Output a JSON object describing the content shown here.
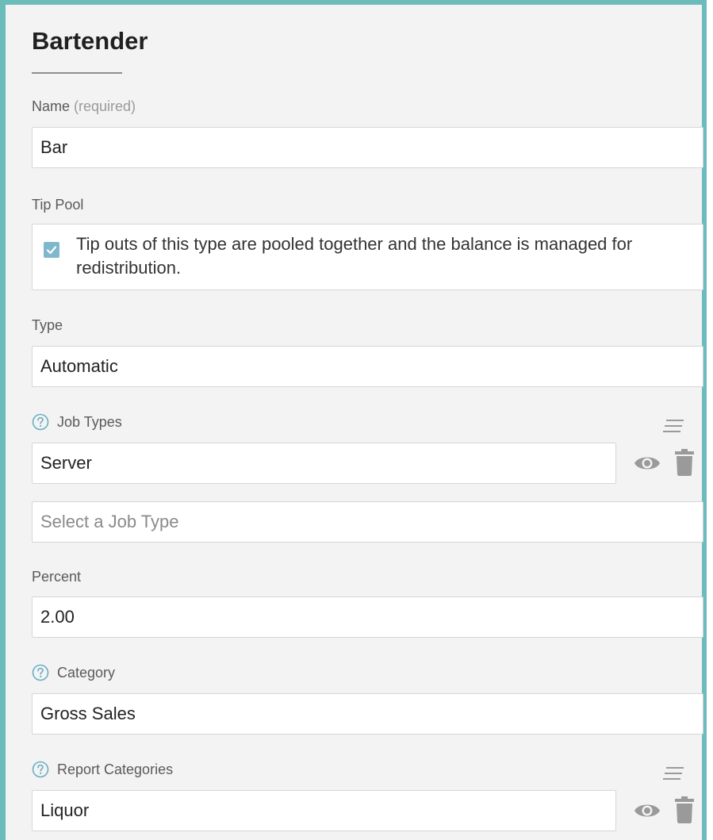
{
  "page": {
    "title": "Bartender"
  },
  "form": {
    "name": {
      "label": "Name",
      "label_hint": "(required)",
      "value": "Bar"
    },
    "tip_pool": {
      "label": "Tip Pool",
      "checked": true,
      "description": "Tip outs of this type are pooled together and the balance is managed for redistribution."
    },
    "type": {
      "label": "Type",
      "value": "Automatic"
    },
    "job_types": {
      "label": "Job Types",
      "items": [
        {
          "value": "Server"
        }
      ],
      "add_placeholder": "Select a Job Type"
    },
    "percent": {
      "label": "Percent",
      "value": "2.00"
    },
    "category": {
      "label": "Category",
      "value": "Gross Sales"
    },
    "report_categories": {
      "label": "Report Categories",
      "items": [
        {
          "value": "Liquor"
        }
      ]
    }
  },
  "colors": {
    "panel_border": "#6cbcbc",
    "panel_background": "#f3f3f3",
    "checkbox": "#7fb8cc",
    "help_icon": "#6aaec4",
    "action_icon": "#9a9a9a"
  },
  "icons": {
    "help": "question-circle-icon",
    "sort": "sort-lines-icon",
    "view": "eye-icon",
    "delete": "trash-icon",
    "check": "checkmark-icon"
  }
}
